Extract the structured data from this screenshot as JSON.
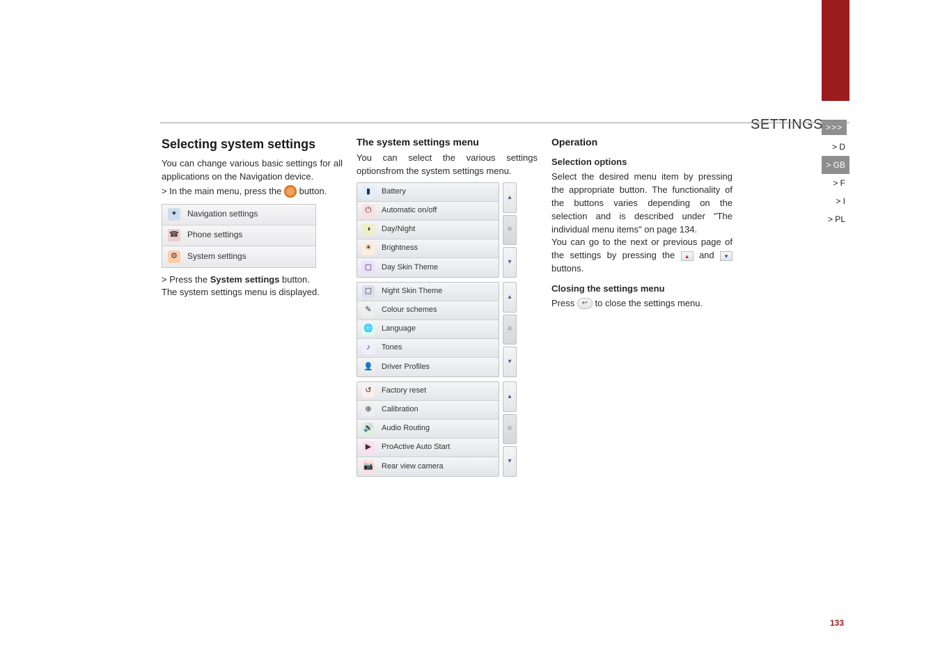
{
  "header": {
    "section_label": "SETTINGS",
    "chevron": ">>>"
  },
  "sidebar": {
    "items": [
      {
        "label": "> D"
      },
      {
        "label": "> GB"
      },
      {
        "label": "> F"
      },
      {
        "label": "> I"
      },
      {
        "label": "> PL"
      }
    ],
    "active_index": 1
  },
  "col1": {
    "heading": "Selecting system settings",
    "intro": "You can change various basic settings for all applications on the Navigation device.",
    "step1_prefix": "> In the main menu, press the ",
    "step1_suffix": " button.",
    "menu_items": [
      {
        "label": "Navigation settings",
        "icon_name": "compass-icon"
      },
      {
        "label": "Phone settings",
        "icon_name": "phone-icon"
      },
      {
        "label": "System settings",
        "icon_name": "gears-icon"
      }
    ],
    "step2_prefix": "> Press the ",
    "system_settings_label": "System settings",
    "step2_suffix": " button.",
    "result": "The system settings menu is displayed."
  },
  "col2": {
    "heading": "The system settings menu",
    "intro": "You can select the various settings optionsfrom the system settings menu.",
    "groups": [
      [
        {
          "label": "Battery",
          "icon_name": "battery-icon"
        },
        {
          "label": "Automatic on/off",
          "icon_name": "power-icon"
        },
        {
          "label": "Day/Night",
          "icon_name": "daynight-icon"
        },
        {
          "label": "Brightness",
          "icon_name": "brightness-icon"
        },
        {
          "label": "Day Skin Theme",
          "icon_name": "theme-day-icon"
        }
      ],
      [
        {
          "label": "Night Skin Theme",
          "icon_name": "theme-night-icon"
        },
        {
          "label": "Colour schemes",
          "icon_name": "palette-icon"
        },
        {
          "label": "Language",
          "icon_name": "globe-icon"
        },
        {
          "label": "Tones",
          "icon_name": "tones-icon"
        },
        {
          "label": "Driver Profiles",
          "icon_name": "profiles-icon"
        }
      ],
      [
        {
          "label": "Factory reset",
          "icon_name": "reset-icon"
        },
        {
          "label": "Calibration",
          "icon_name": "calibration-icon"
        },
        {
          "label": "Audio Routing",
          "icon_name": "audio-icon"
        },
        {
          "label": "ProActive Auto Start",
          "icon_name": "autostart-icon"
        },
        {
          "label": "Rear view camera",
          "icon_name": "camera-icon"
        }
      ]
    ],
    "scroll_up_glyph": "▴",
    "scroll_mid_glyph": "≡",
    "scroll_down_glyph": "▾"
  },
  "col3": {
    "heading": "Operation",
    "sub1_heading": "Selection options",
    "sub1_text": "Select the desired menu item by pressing the appropriate button. The functionality of the buttons varies depending on the selection and is described under \"The individual menu items\" on page 134.",
    "paging_prefix": "You can go to the next or previous page of the settings by pressing the ",
    "paging_and": " and ",
    "paging_suffix": " buttons.",
    "up_glyph": "▴",
    "down_glyph": "▾",
    "sub2_heading": "Closing the settings menu",
    "sub2_prefix": "Press ",
    "back_glyph": "↩",
    "sub2_suffix": " to close the settings menu."
  },
  "page_number": "133",
  "colors": {
    "accent_red": "#9b1c1c",
    "header_grey": "#8e8e8e"
  }
}
